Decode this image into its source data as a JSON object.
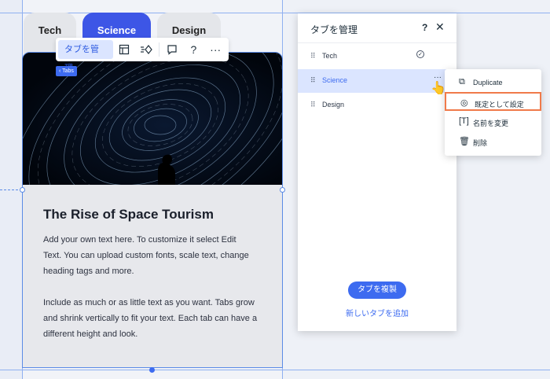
{
  "tabs": [
    "Tech",
    "Science",
    "Design"
  ],
  "toolbar": {
    "manage_label": "タブを管理",
    "help_label": "?",
    "more_label": "···"
  },
  "tabs_badge": "‹ Tabs",
  "content": {
    "title": "The Rise of Space Tourism",
    "para1_line1": "Add your own text here. To customize it select Edit",
    "para1_line2": "Text. You can upload custom fonts, scale text, change",
    "para1_line3": "heading tags and more.",
    "para2_line1": "Include as much or as little text as you want. Tabs grow",
    "para2_line2": "and shrink vertically to fit your text. Each tab can have a",
    "para2_line3": "different height and look."
  },
  "panel": {
    "title": "タブを管理",
    "help": "?",
    "close": "✕",
    "items": [
      {
        "label": "Tech"
      },
      {
        "label": "Science"
      },
      {
        "label": "Design"
      }
    ],
    "duplicate_button": "タブを複製",
    "add_link": "新しいタブを追加"
  },
  "context_menu": {
    "items": [
      {
        "label": "Duplicate"
      },
      {
        "label": "既定として設定"
      },
      {
        "label": "名前を変更"
      },
      {
        "label": "削除"
      }
    ]
  },
  "colors": {
    "accent": "#3d6bf0",
    "active_tab": "#3d56e6",
    "highlight_border": "#f07a4a"
  }
}
